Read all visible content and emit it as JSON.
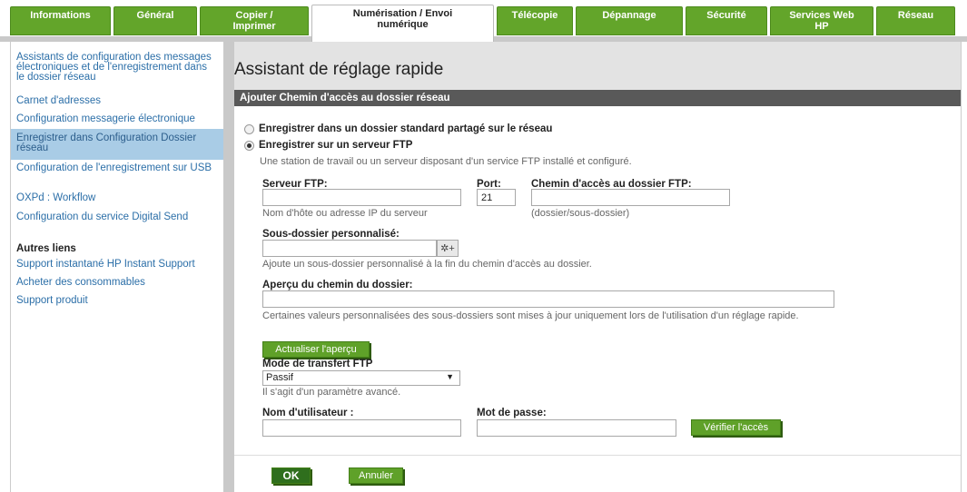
{
  "tabs": [
    {
      "label": "Informations"
    },
    {
      "label": "Général"
    },
    {
      "label": "Copier /\nImprimer"
    },
    {
      "label": "Numérisation / Envoi\nnumérique"
    },
    {
      "label": "Télécopie"
    },
    {
      "label": "Dépannage"
    },
    {
      "label": "Sécurité"
    },
    {
      "label": "Services Web\nHP"
    },
    {
      "label": "Réseau"
    }
  ],
  "sidebar": {
    "items": [
      {
        "label": "Assistants de configuration des messages électroniques et de l'enregistrement dans le dossier réseau"
      },
      {
        "label": "Carnet d'adresses"
      },
      {
        "label": "Configuration messagerie électronique"
      },
      {
        "label": "Enregistrer dans Configuration Dossier réseau"
      },
      {
        "label": "Configuration de l'enregistrement sur USB"
      },
      {
        "label": "OXPd : Workflow"
      },
      {
        "label": "Configuration du service Digital Send"
      }
    ],
    "other_links_heading": "Autres liens",
    "other_links": [
      {
        "label": "Support instantané HP Instant Support"
      },
      {
        "label": "Acheter des consommables"
      },
      {
        "label": "Support produit"
      }
    ]
  },
  "main": {
    "title": "Assistant de réglage rapide",
    "section_title": "Ajouter Chemin d'accès au dossier réseau",
    "radio_standard_label": "Enregistrer dans un dossier standard partagé sur le réseau",
    "radio_ftp_label": "Enregistrer sur un serveur FTP",
    "ftp_description": "Une station de travail ou un serveur disposant d'un service FTP installé et configuré.",
    "ftp_server_label": "Serveur FTP:",
    "ftp_server_value": "",
    "ftp_server_hint": "Nom d'hôte ou adresse IP du serveur",
    "port_label": "Port:",
    "port_value": "21",
    "ftp_path_label": "Chemin d'accès au dossier FTP:",
    "ftp_path_value": "",
    "ftp_path_hint": "(dossier/sous-dossier)",
    "subfolder_label": "Sous-dossier personnalisé:",
    "subfolder_value": "",
    "subfolder_hint": "Ajoute un sous-dossier personnalisé à la fin du chemin d'accès au dossier.",
    "preview_label": "Aperçu du chemin du dossier:",
    "preview_value": "",
    "preview_hint": "Certaines valeurs personnalisées des sous-dossiers sont mises à jour uniquement lors de l'utilisation d'un réglage rapide.",
    "refresh_preview_button": "Actualiser l'aperçu",
    "transfer_mode_label": "Mode de transfert FTP",
    "transfer_mode_value": "Passif",
    "transfer_mode_arrow": "▼",
    "transfer_mode_hint": "Il s'agit d'un paramètre avancé.",
    "username_label": "Nom d'utilisateur :",
    "username_value": "",
    "password_label": "Mot de passe:",
    "password_value": "",
    "verify_access_button": "Vérifier l'accès",
    "ok_button": "OK",
    "cancel_button": "Annuler"
  },
  "colors": {
    "tab_green": "#63a52a",
    "link_blue": "#2c6fa8",
    "selected_bg": "#a9cce6",
    "section_bar": "#595959"
  },
  "icons": {
    "subfolder_picker": "gear-plus-icon"
  }
}
